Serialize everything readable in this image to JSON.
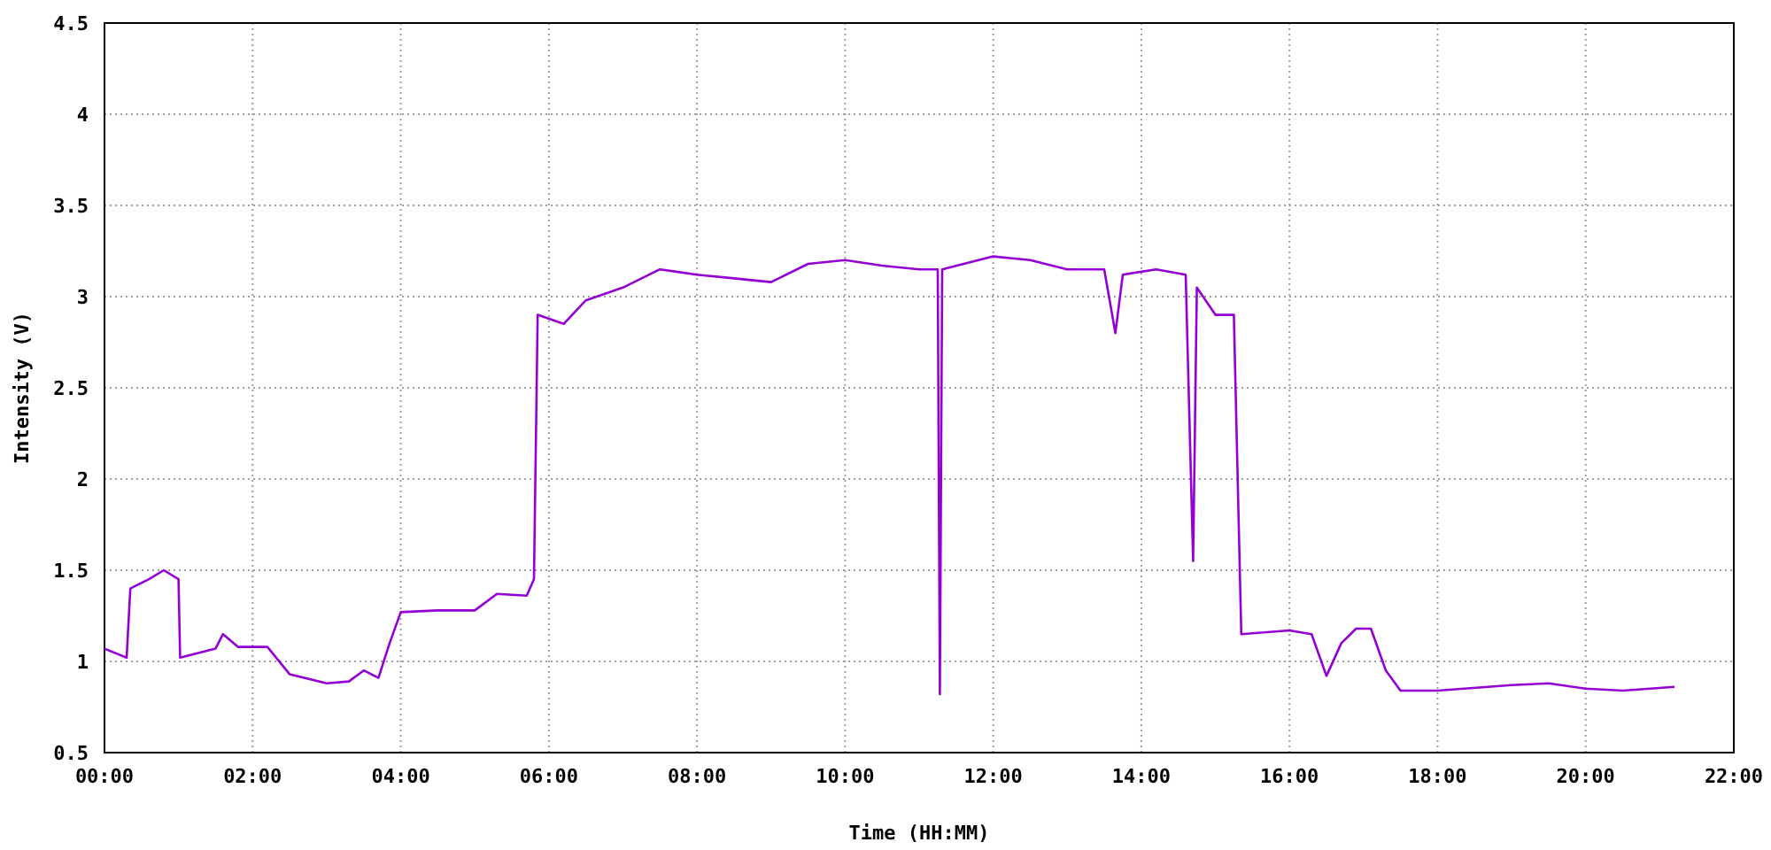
{
  "chart": {
    "chart_data": {
      "type": "line",
      "grid": true,
      "xlabel": "Time (HH:MM)",
      "ylabel": "Intensity (V)",
      "x": [
        0,
        0.3,
        0.35,
        0.6,
        0.8,
        1.0,
        1.02,
        1.3,
        1.5,
        1.6,
        1.8,
        2.2,
        2.5,
        3.0,
        3.3,
        3.5,
        3.7,
        3.85,
        4.0,
        4.5,
        5.0,
        5.3,
        5.7,
        5.8,
        5.85,
        6.2,
        6.5,
        7.0,
        7.5,
        8.0,
        8.5,
        9.0,
        9.5,
        10.0,
        10.5,
        11.0,
        11.25,
        11.28,
        11.31,
        12.0,
        12.5,
        13.0,
        13.5,
        13.65,
        13.75,
        14.2,
        14.6,
        14.7,
        14.75,
        15.0,
        15.25,
        15.35,
        16.0,
        16.3,
        16.5,
        16.7,
        16.9,
        17.1,
        17.3,
        17.5,
        18.0,
        19.0,
        19.5,
        20.0,
        20.5,
        21.2
      ],
      "series": [
        {
          "color": "#9400d3",
          "values": [
            1.07,
            1.02,
            1.4,
            1.45,
            1.5,
            1.45,
            1.02,
            1.05,
            1.07,
            1.15,
            1.08,
            1.08,
            0.93,
            0.88,
            0.89,
            0.95,
            0.91,
            1.1,
            1.27,
            1.28,
            1.28,
            1.37,
            1.36,
            1.45,
            2.9,
            2.85,
            2.98,
            3.05,
            3.15,
            3.12,
            3.1,
            3.08,
            3.18,
            3.2,
            3.17,
            3.15,
            3.15,
            0.82,
            3.15,
            3.22,
            3.2,
            3.15,
            3.15,
            2.8,
            3.12,
            3.15,
            3.12,
            1.55,
            3.05,
            2.9,
            2.9,
            1.15,
            1.17,
            1.15,
            0.92,
            1.1,
            1.18,
            1.18,
            0.95,
            0.84,
            0.84,
            0.87,
            0.88,
            0.85,
            0.84,
            0.86
          ]
        }
      ],
      "xlim": [
        0,
        22
      ],
      "ylim": [
        0.5,
        4.5
      ],
      "xticks": [
        {
          "value": 0,
          "label": "00:00"
        },
        {
          "value": 2,
          "label": "02:00"
        },
        {
          "value": 4,
          "label": "04:00"
        },
        {
          "value": 6,
          "label": "06:00"
        },
        {
          "value": 8,
          "label": "08:00"
        },
        {
          "value": 10,
          "label": "10:00"
        },
        {
          "value": 12,
          "label": "12:00"
        },
        {
          "value": 14,
          "label": "14:00"
        },
        {
          "value": 16,
          "label": "16:00"
        },
        {
          "value": 18,
          "label": "18:00"
        },
        {
          "value": 20,
          "label": "20:00"
        },
        {
          "value": 22,
          "label": "22:00"
        }
      ],
      "yticks": [
        0.5,
        1,
        1.5,
        2,
        2.5,
        3,
        3.5,
        4,
        4.5
      ]
    }
  }
}
